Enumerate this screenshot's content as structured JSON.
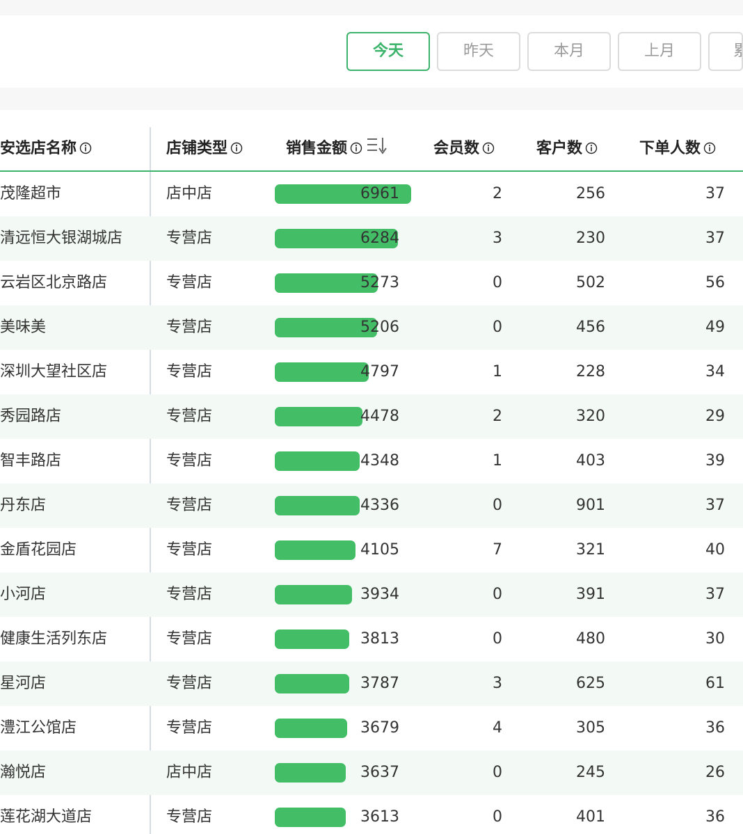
{
  "date_range": {
    "today": "今天",
    "yesterday": "昨天",
    "this_month": "本月",
    "last_month": "上月",
    "cumulative_partial": "累"
  },
  "table": {
    "headers": {
      "store_name": "安选店名称",
      "store_type": "店铺类型",
      "sales_amount": "销售金额",
      "members": "会员数",
      "customers": "客户数",
      "orderers": "下单人数"
    },
    "sales_max": 6961,
    "rows": [
      {
        "name": "茂隆超市",
        "type": "店中店",
        "sales": 6961,
        "members": 2,
        "customers": 256,
        "orderers": 37
      },
      {
        "name": "清远恒大银湖城店",
        "type": "专营店",
        "sales": 6284,
        "members": 3,
        "customers": 230,
        "orderers": 37
      },
      {
        "name": "云岩区北京路店",
        "type": "专营店",
        "sales": 5273,
        "members": 0,
        "customers": 502,
        "orderers": 56
      },
      {
        "name": "美味美",
        "type": "专营店",
        "sales": 5206,
        "members": 0,
        "customers": 456,
        "orderers": 49
      },
      {
        "name": "深圳大望社区店",
        "type": "专营店",
        "sales": 4797,
        "members": 1,
        "customers": 228,
        "orderers": 34
      },
      {
        "name": "秀园路店",
        "type": "专营店",
        "sales": 4478,
        "members": 2,
        "customers": 320,
        "orderers": 29
      },
      {
        "name": "智丰路店",
        "type": "专营店",
        "sales": 4348,
        "members": 1,
        "customers": 403,
        "orderers": 39
      },
      {
        "name": "丹东店",
        "type": "专营店",
        "sales": 4336,
        "members": 0,
        "customers": 901,
        "orderers": 37
      },
      {
        "name": "金盾花园店",
        "type": "专营店",
        "sales": 4105,
        "members": 7,
        "customers": 321,
        "orderers": 40
      },
      {
        "name": "小河店",
        "type": "专营店",
        "sales": 3934,
        "members": 0,
        "customers": 391,
        "orderers": 37
      },
      {
        "name": "健康生活列东店",
        "type": "专营店",
        "sales": 3813,
        "members": 0,
        "customers": 480,
        "orderers": 30
      },
      {
        "name": "星河店",
        "type": "专营店",
        "sales": 3787,
        "members": 3,
        "customers": 625,
        "orderers": 61
      },
      {
        "name": "澧江公馆店",
        "type": "专营店",
        "sales": 3679,
        "members": 4,
        "customers": 305,
        "orderers": 36
      },
      {
        "name": "瀚悦店",
        "type": "店中店",
        "sales": 3637,
        "members": 0,
        "customers": 245,
        "orderers": 26
      },
      {
        "name": "莲花湖大道店",
        "type": "专营店",
        "sales": 3613,
        "members": 0,
        "customers": 401,
        "orderers": 36
      }
    ]
  },
  "colors": {
    "accent": "#3bb36a",
    "bar": "#43be67",
    "row_alt": "#f3faf6"
  },
  "icons": {
    "header_info": "info-circle-icon",
    "sort": "sort-descending-icon"
  }
}
